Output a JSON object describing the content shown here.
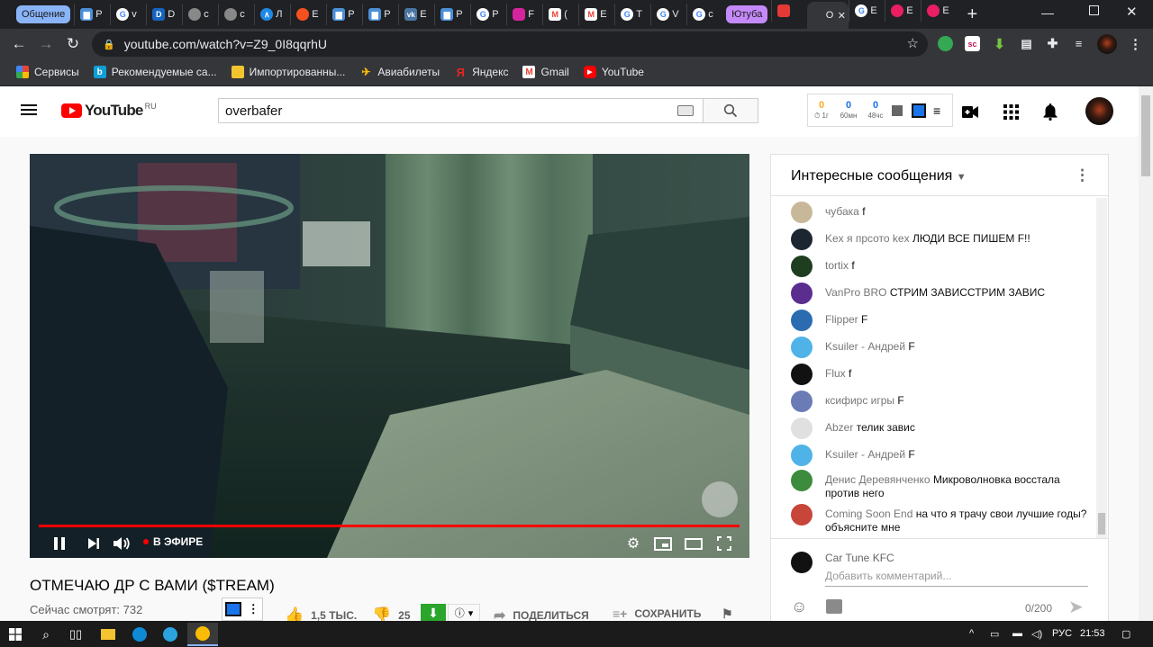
{
  "browser": {
    "tab_groups": {
      "group1": "Общение",
      "group2": "Ютуба"
    },
    "tabs": [
      {
        "t": "Р",
        "fav": "chat",
        "color": "#4a90d9"
      },
      {
        "t": "v",
        "fav": "G",
        "color": "#4285f4"
      },
      {
        "t": "D",
        "fav": "D",
        "color": "#1565c0"
      },
      {
        "t": "c",
        "fav": "globe",
        "color": "#888888"
      },
      {
        "t": "c",
        "fav": "globe",
        "color": "#888888"
      },
      {
        "t": "Л",
        "fav": "A",
        "color": "#1e88e5"
      },
      {
        "t": "Е",
        "fav": "o",
        "color": "#f4511e"
      },
      {
        "t": "Р",
        "fav": "chat",
        "color": "#4a90d9"
      },
      {
        "t": "Р",
        "fav": "chat",
        "color": "#4a90d9"
      },
      {
        "t": "Е",
        "fav": "vk",
        "color": "#4c75a3"
      },
      {
        "t": "Р",
        "fav": "chat",
        "color": "#4a90d9"
      },
      {
        "t": "Р",
        "fav": "G",
        "color": "#4285f4"
      },
      {
        "t": "F",
        "fav": "ig",
        "color": "#d6249f"
      },
      {
        "t": "(",
        "fav": "M",
        "color": "#ea4335"
      },
      {
        "t": "E",
        "fav": "M",
        "color": "#ea4335"
      },
      {
        "t": "T",
        "fav": "G",
        "color": "#4285f4"
      },
      {
        "t": "V",
        "fav": "G",
        "color": "#4285f4"
      },
      {
        "t": "c",
        "fav": "G",
        "color": "#4285f4"
      }
    ],
    "group2_tabs": [
      {
        "t": "",
        "fav": "yt",
        "color": "#e53935"
      },
      {
        "t": "O",
        "fav": "active",
        "color": "#ffffff",
        "close": "✕"
      },
      {
        "t": "E",
        "fav": "G",
        "color": "#4285f4"
      },
      {
        "t": "E",
        "fav": "o",
        "color": "#e91e63"
      },
      {
        "t": "Е",
        "fav": "o",
        "color": "#e91e63"
      }
    ],
    "new_tab": "+",
    "url": "youtube.com/watch?v=Z9_0I8qqrhU",
    "bookmarks": [
      {
        "label": "Сервисы",
        "icon": "apps-grid",
        "color": "#4285f4"
      },
      {
        "label": "Рекомендуемые са...",
        "icon": "bing-b",
        "color": "#0f9ed5"
      },
      {
        "label": "Импортированны...",
        "icon": "folder",
        "color": "#f4c430"
      },
      {
        "label": "Авиабилеты",
        "icon": "plane",
        "color": "#fbbc05"
      },
      {
        "label": "Яндекс",
        "icon": "ya",
        "color": "#e52620"
      },
      {
        "label": "Gmail",
        "icon": "gmail",
        "color": "#ea4335"
      },
      {
        "label": "YouTube",
        "icon": "yt",
        "color": "#ff0000"
      }
    ]
  },
  "youtube": {
    "region": "RU",
    "search_value": "overbafer",
    "widget_stats": [
      {
        "n": "0",
        "l": "⏱ 1г",
        "color": "#f9a825"
      },
      {
        "n": "0",
        "l": "60мн",
        "color": "#1a73e8"
      },
      {
        "n": "0",
        "l": "48чс",
        "color": "#1a73e8"
      }
    ],
    "video": {
      "live_label": "В ЭФИРЕ",
      "title": "ОТМЕЧАЮ ДР С ВАМИ ($TREAM)",
      "viewers": "Сейчас смотрят: 732",
      "likes": "1,5 ТЫС.",
      "dislikes": "25",
      "share": "ПОДЕЛИТЬСЯ",
      "save": "СОХРАНИТЬ"
    },
    "chat": {
      "header": "Интересные сообщения",
      "messages": [
        {
          "author": "чубака",
          "text": "f",
          "av": "#c8b89a"
        },
        {
          "author": "Kex я прсото kex",
          "text": "ЛЮДИ ВСЕ ПИШЕМ F!!",
          "av": "#1c2630"
        },
        {
          "author": "tortix",
          "text": "f",
          "av": "#1f3d1f"
        },
        {
          "author": "VanPro BRO",
          "text": "СТРИМ ЗАВИССТРИМ ЗАВИС",
          "av": "#5b2d8f"
        },
        {
          "author": "Flipper",
          "text": "F",
          "av": "#2b6cb0"
        },
        {
          "author": "Ksuiler - Андрей",
          "text": "F",
          "av": "#4fb3e8"
        },
        {
          "author": "Flux",
          "text": "f",
          "av": "#111111"
        },
        {
          "author": "ксифирс игры",
          "text": "F",
          "av": "#6a7bb5"
        },
        {
          "author": "Abzer",
          "text": "телик завис",
          "av": "#e0e0e0"
        },
        {
          "author": "Ksuiler - Андрей",
          "text": "F",
          "av": "#4fb3e8"
        },
        {
          "author": "Денис Деревянченко",
          "text": "Микроволновка восстала против него",
          "av": "#3d8b3d"
        },
        {
          "author": "Coming Soon End",
          "text": "на что я трачу свои лучшие годы? объясните мне",
          "av": "#c8453a"
        }
      ],
      "input_author": "Car Tune KFC",
      "input_placeholder": "Добавить комментарий...",
      "counter": "0/200"
    }
  },
  "taskbar": {
    "lang": "РУС",
    "time": "21:53"
  },
  "colors": {
    "accent_red": "#ff0000",
    "chrome_dark": "#202124",
    "chrome_mid": "#35363a"
  }
}
